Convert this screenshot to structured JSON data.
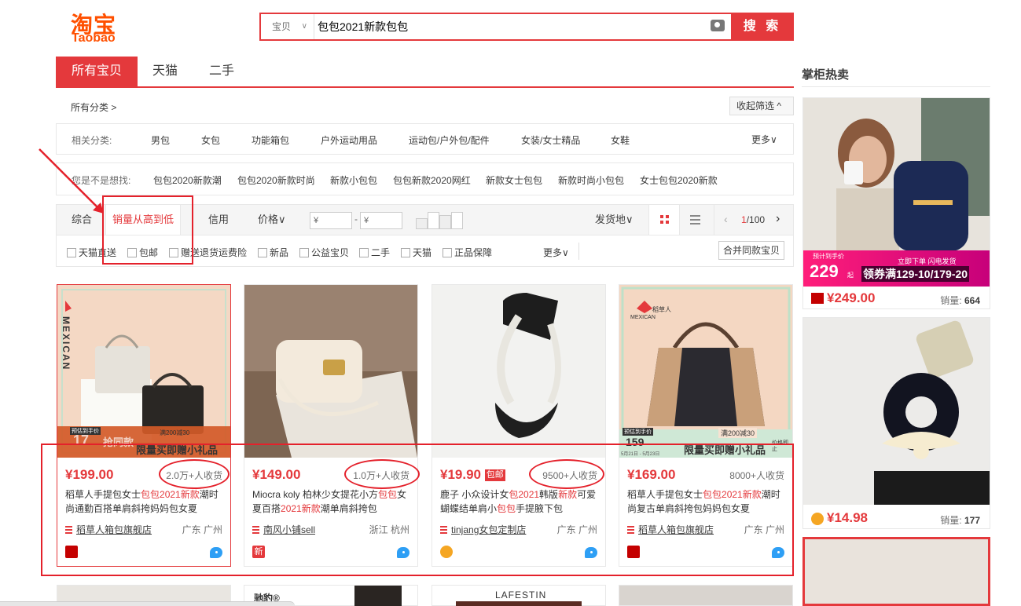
{
  "header": {
    "logo_cn": "淘宝",
    "logo_en": "Taobao",
    "search_type": "宝贝",
    "search_value": "包包2021新款包包",
    "search_button": "搜 索"
  },
  "tabs": [
    "所有宝贝",
    "天猫",
    "二手"
  ],
  "category": {
    "all_label": "所有分类 >",
    "collapse_label": "收起筛选 ^",
    "related_label": "相关分类:",
    "related_items": [
      "男包",
      "女包",
      "功能箱包",
      "户外运动用品",
      "运动包/户外包/配件",
      "女装/女士精品",
      "女鞋"
    ],
    "more_label": "更多∨",
    "suggest_label": "您是不是想找:",
    "suggest_items": [
      "包包2020新款潮",
      "包包2020新款时尚",
      "新款小包包",
      "包包新款2020网红",
      "新款女士包包",
      "新款时尚小包包",
      "女士包包2020新款"
    ]
  },
  "sort": {
    "items": [
      "综合",
      "销量从高到低",
      "信用",
      "价格∨"
    ],
    "price_from": "¥",
    "price_to": "¥",
    "price_sep": "-",
    "ship_from": "发货地∨",
    "page_current": "1",
    "page_total": "/100"
  },
  "filters": {
    "items": [
      "天猫直送",
      "包邮",
      "赠送退货运费险",
      "新品",
      "公益宝贝",
      "二手",
      "天猫",
      "正品保障"
    ],
    "more_label": "更多∨",
    "merge_label": "合并同款宝贝"
  },
  "products": [
    {
      "price": "¥199.00",
      "sold": "2.0万+人收货",
      "title_parts": [
        "稻草人手提包女士",
        "包包2021新款",
        "潮时尚通勤百搭单肩斜挎妈妈包女夏"
      ],
      "shop": "稻草人箱包旗舰店",
      "location": "广东 广州",
      "img_brand": "MEXICAN",
      "img_promo_1": "预估到手价",
      "img_promo_2": "满200减30",
      "img_promo_3": "限量买即赠小礼品",
      "img_promo_4": "17",
      "img_promo_5": "抢同款",
      "badge_color": "#c40000"
    },
    {
      "price": "¥149.00",
      "sold": "1.0万+人收货",
      "title_parts": [
        "Miocra koly 柏林少女提花小方",
        "包包",
        "女夏百搭",
        "2021新款",
        "潮单肩斜挎包"
      ],
      "shop": "南风小铺sell",
      "location": "浙江 杭州",
      "badge_text": "新",
      "badge_color": "#e4393c"
    },
    {
      "price": "¥19.90",
      "price_tag": "包邮",
      "sold": "9500+人收货",
      "title_parts": [
        "鹿子 小众设计女",
        "包2021",
        "韩版",
        "新款",
        "可爱蝴蝶结单肩小",
        "包包",
        "手提腋下包"
      ],
      "shop": "tinjang女包定制店",
      "location": "广东 广州",
      "badge_color": "#f5a623"
    },
    {
      "price": "¥169.00",
      "sold": "8000+人收货",
      "title_parts": [
        "稻草人手提包女士",
        "包包2021新款",
        "潮时尚复古单肩斜挎包妈妈包女夏"
      ],
      "shop": "稻草人箱包旗舰店",
      "location": "广东 广州",
      "img_brand_cn": "稻草人",
      "img_brand": "MEXICAN",
      "img_promo_1": "预估到手价",
      "img_promo_2": "满200减30",
      "img_promo_3": "限量买即赠小礼品",
      "img_promo_4": "159",
      "img_promo_5": "价格即止",
      "img_promo_6": "5月21日 - 5月23日",
      "badge_color": "#c40000"
    }
  ],
  "next_row": {
    "brand_2": "驰豹®",
    "brand_3": "LAFESTIN"
  },
  "hot": {
    "title": "掌柜热卖",
    "items": [
      {
        "price": "¥249.00",
        "sales": "664",
        "sales_label": "销量:",
        "banner_small": "预计到手价",
        "banner_price": "229",
        "banner_unit": "起",
        "banner_right": "立即下单 闪电发货",
        "banner_coupon": "领券满129-10/179-20"
      },
      {
        "price": "¥14.98",
        "sales": "177",
        "sales_label": "销量:"
      }
    ]
  },
  "colors": {
    "accent": "#e4393c",
    "brand_orange": "#ff5000",
    "annotation": "#e4212b"
  }
}
